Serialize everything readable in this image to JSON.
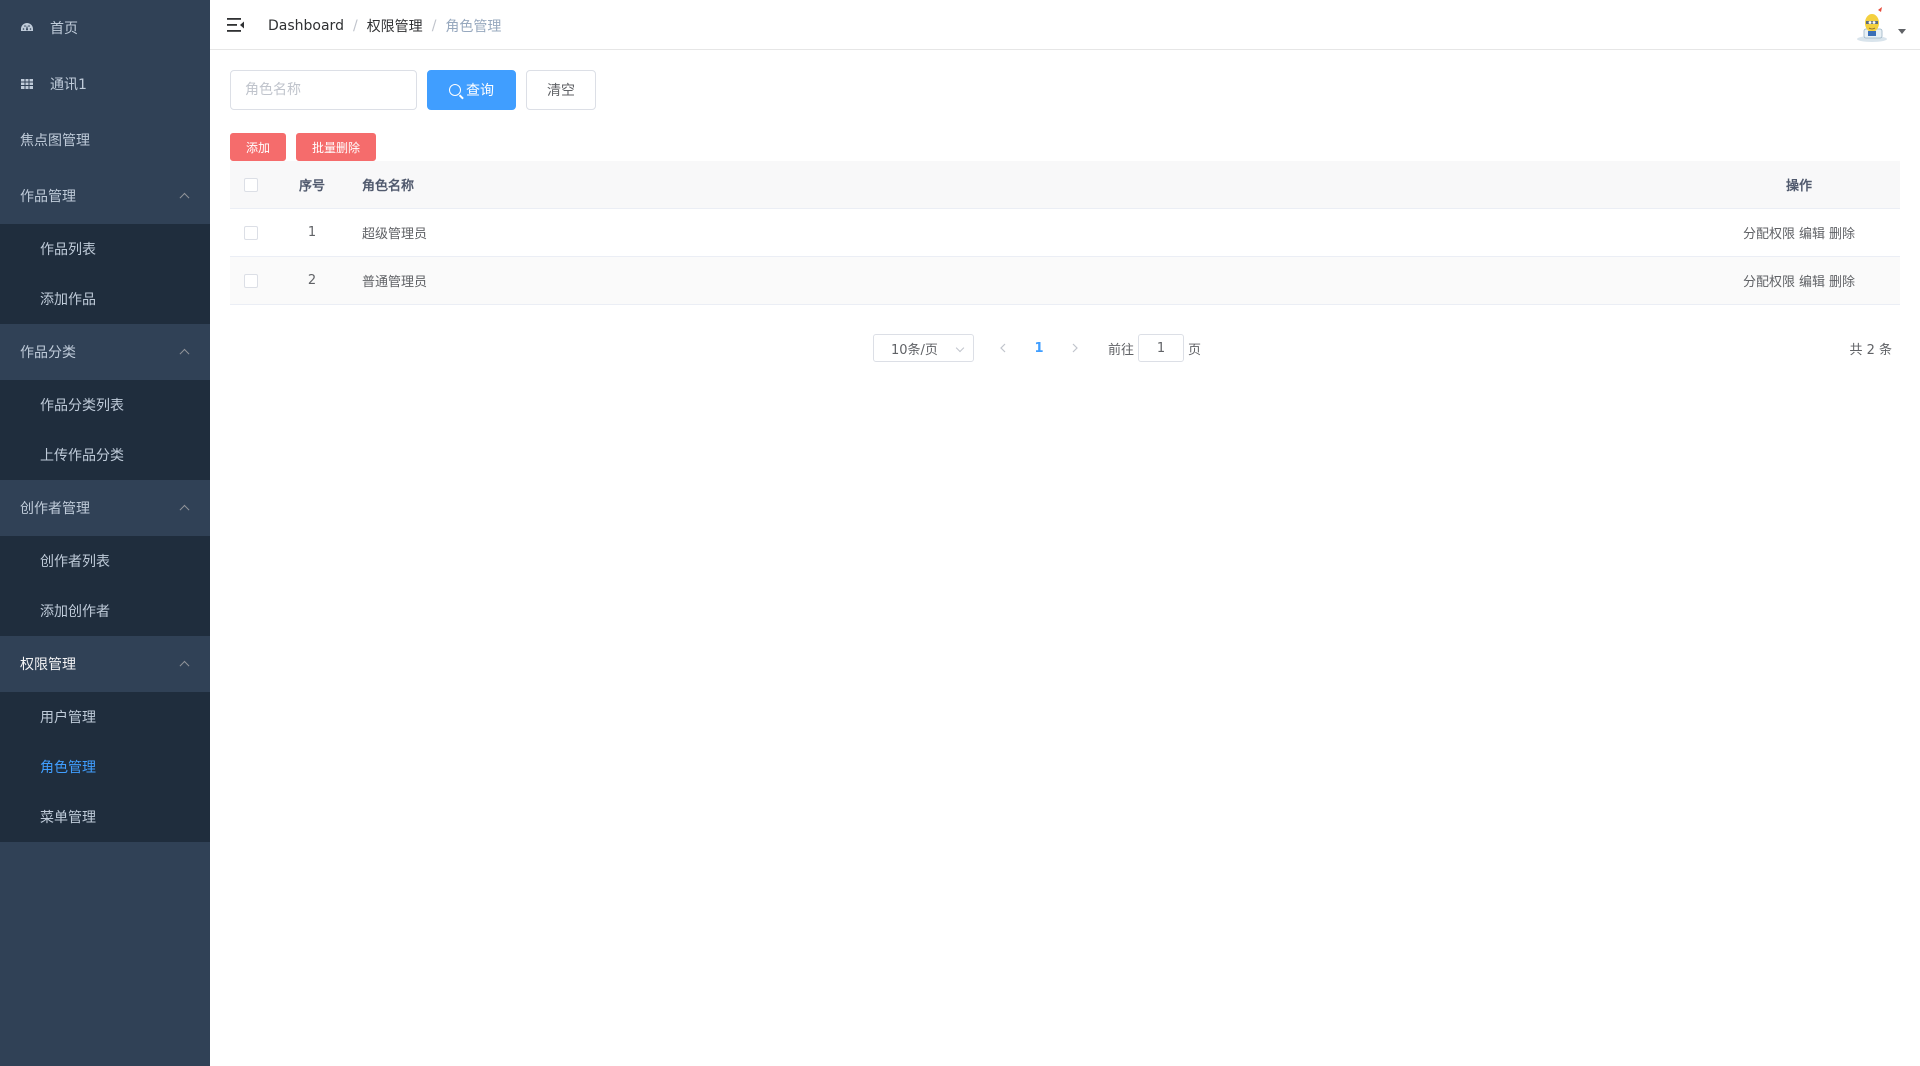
{
  "sidebar": {
    "items": [
      {
        "label": "首页",
        "icon": "dashboard-icon"
      },
      {
        "label": "通讯1",
        "icon": "table-icon"
      },
      {
        "label": "焦点图管理",
        "icon": ""
      }
    ],
    "groups": [
      {
        "title": "作品管理",
        "children": [
          "作品列表",
          "添加作品"
        ]
      },
      {
        "title": "作品分类",
        "children": [
          "作品分类列表",
          "上传作品分类"
        ]
      },
      {
        "title": "创作者管理",
        "children": [
          "创作者列表",
          "添加创作者"
        ]
      },
      {
        "title": "权限管理",
        "children": [
          "用户管理",
          "角色管理",
          "菜单管理"
        ],
        "active_child": "角色管理"
      }
    ]
  },
  "navbar": {
    "breadcrumb": [
      "Dashboard",
      "权限管理",
      "角色管理"
    ]
  },
  "filter": {
    "placeholder": "角色名称",
    "search_label": "查询",
    "clear_label": "清空"
  },
  "actions": {
    "add_label": "添加",
    "batch_delete_label": "批量删除"
  },
  "table": {
    "headers": {
      "index": "序号",
      "name": "角色名称",
      "ops": "操作"
    },
    "rows": [
      {
        "index": "1",
        "name": "超级管理员",
        "ops": [
          "分配权限",
          "编辑",
          "删除"
        ]
      },
      {
        "index": "2",
        "name": "普通管理员",
        "ops": [
          "分配权限",
          "编辑",
          "删除"
        ]
      }
    ]
  },
  "pagination": {
    "page_size": "10条/页",
    "current_page": "1",
    "goto_prefix": "前往",
    "goto_value": "1",
    "goto_suffix": "页",
    "total": "共 2 条"
  },
  "colors": {
    "sidebar_bg": "#304156",
    "submenu_bg": "#1f2d3d",
    "primary": "#409eff",
    "danger": "#f56c6c"
  }
}
